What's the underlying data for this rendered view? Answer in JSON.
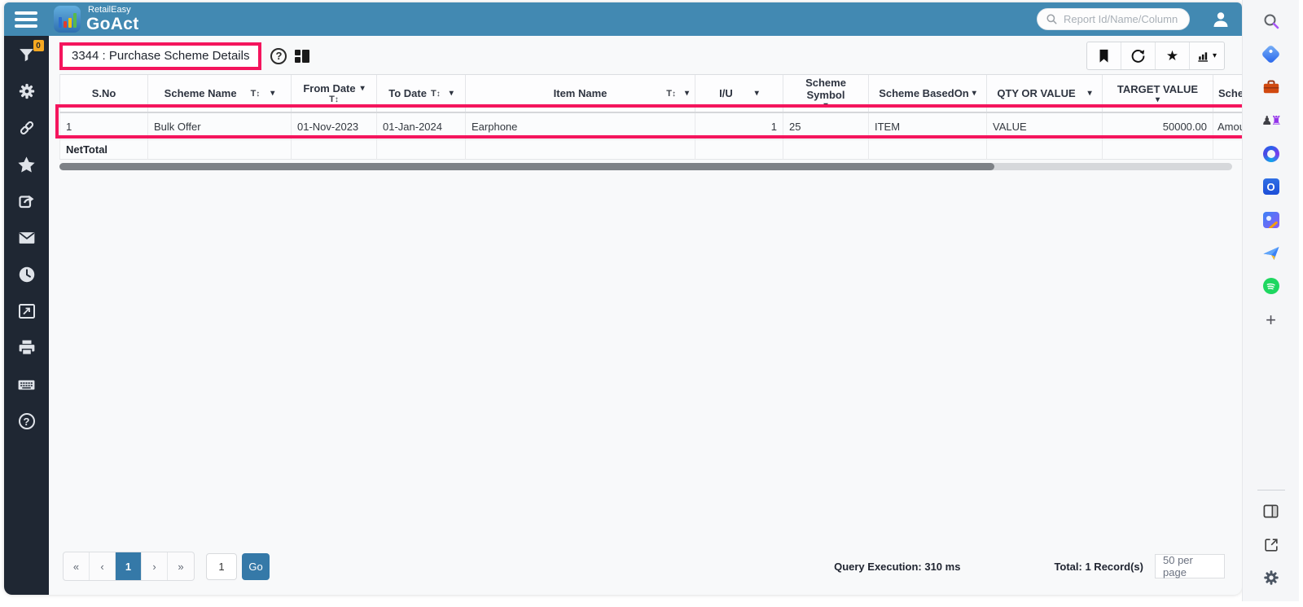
{
  "topbar": {
    "brand_small": "RetailEasy",
    "brand_large": "GoAct",
    "search_placeholder": "Report Id/Name/Column"
  },
  "left_sidebar": {
    "filter_badge": "0",
    "icons": [
      "filter",
      "settings-gear",
      "link",
      "favorites-star",
      "share-export",
      "mail",
      "history-clock",
      "report-window",
      "print",
      "keyboard",
      "help"
    ]
  },
  "right_rail": {
    "icons": [
      "search",
      "shopping-tag",
      "toolbox",
      "games-chess",
      "microsoft-loop",
      "outlook",
      "image-designer",
      "send-plane",
      "spotify",
      "add-plus",
      "split-screen",
      "open-external",
      "settings-gear"
    ],
    "outlook_letter": "O"
  },
  "report": {
    "title": "3344 : Purchase Scheme Details"
  },
  "toolbar": {
    "icons": [
      "bookmark",
      "refresh",
      "favorite-star",
      "chart-type-dropdown"
    ]
  },
  "table": {
    "columns": [
      {
        "label": "S.No"
      },
      {
        "label": "Scheme Name"
      },
      {
        "label": "From Date"
      },
      {
        "label": "To Date"
      },
      {
        "label": "Item Name"
      },
      {
        "label": "I/U"
      },
      {
        "label": "Scheme Symbol"
      },
      {
        "label": "Scheme BasedOn"
      },
      {
        "label": "QTY OR VALUE"
      },
      {
        "label": "TARGET VALUE"
      },
      {
        "label": "Scheme"
      }
    ],
    "row": {
      "sno": "1",
      "scheme_name": "Bulk Offer",
      "from_date": "01-Nov-2023",
      "to_date": "01-Jan-2024",
      "item_name": "Earphone",
      "iu": "1",
      "scheme_symbol": "25",
      "scheme_basedon": "ITEM",
      "qty_or_value": "VALUE",
      "target_value": "50000.00",
      "scheme": "Amount"
    },
    "net_total_label": "NetTotal"
  },
  "pagination": {
    "first": "«",
    "prev": "‹",
    "current_page": "1",
    "next": "›",
    "last": "»",
    "input_value": "1",
    "go_label": "Go"
  },
  "status": {
    "query_execution": "Query Execution: 310 ms",
    "total_records": "Total: 1 Record(s)",
    "page_size": "50 per page"
  },
  "colors": {
    "topbar_blue": "#4289b2",
    "sidebar_dark": "#1f2733",
    "annotation_red": "#f4155d",
    "accent_blue": "#3579a8",
    "badge_orange": "#f6a821"
  }
}
